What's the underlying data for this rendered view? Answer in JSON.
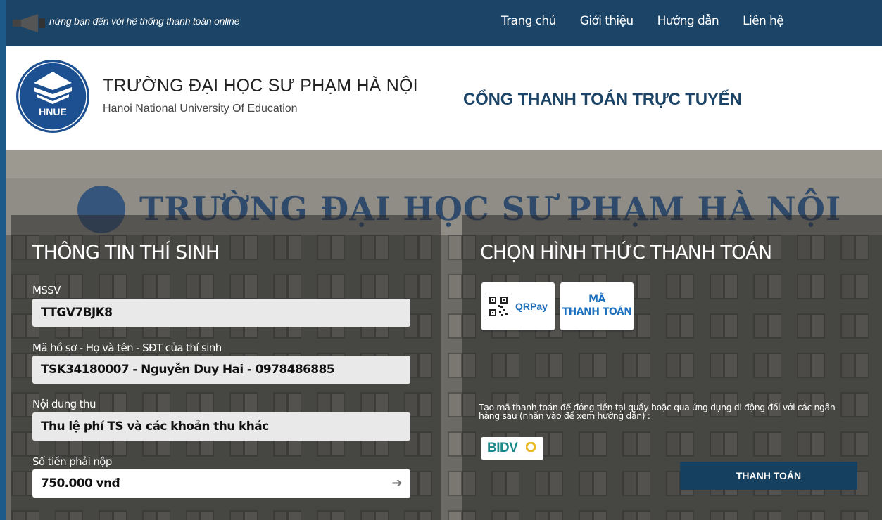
{
  "topbar": {
    "tagline": "nừng bạn đến với hệ thống thanh toán online",
    "nav": [
      "Trang chủ",
      "Giới thiệu",
      "Hướng dẫn",
      "Liên hệ"
    ]
  },
  "header": {
    "logo_text": "HNUE",
    "university_name": "TRƯỜNG ĐẠI HỌC SƯ PHẠM HÀ NỘI",
    "university_name_en": "Hanoi National University Of Education",
    "portal_title": "CỔNG THANH TOÁN TRỰC TUYẾN"
  },
  "hero": {
    "banner_text": "TRƯỜNG ĐẠI HỌC SƯ PHẠM HÀ NỘI"
  },
  "student_info": {
    "title": "THÔNG TIN THÍ SINH",
    "fields": [
      {
        "label": "MSSV",
        "value": "TTGV7BJK8"
      },
      {
        "label": "Mã hồ sơ - Họ và tên - SĐT của thí sinh",
        "value": "TSK34180007 - Nguyễn Duy Hai - 0978486885"
      },
      {
        "label": "Nội dung thu",
        "value": "Thu lệ phí TS  và các khoản thu khác"
      },
      {
        "label": "Số tiền phải nộp",
        "value": "750.000 vnđ"
      }
    ]
  },
  "payment": {
    "title": "CHỌN HÌNH THỨC THANH TOÁN",
    "options": {
      "qr_label": "QRPay",
      "code_label_line1": "MÃ",
      "code_label_line2": "THANH TOÁN"
    },
    "info_text": "Tạo mã thanh toán để đóng tiền tại quầy hoặc qua ứng dụng di động đối với các ngân hàng sau (nhấn vào để xem hướng dẫn) :",
    "bank": "BIDV",
    "submit_label": "THANH TOÁN"
  },
  "colors": {
    "topbar": "#1b4467",
    "accent": "#1d6fbe",
    "button": "#16405f"
  }
}
